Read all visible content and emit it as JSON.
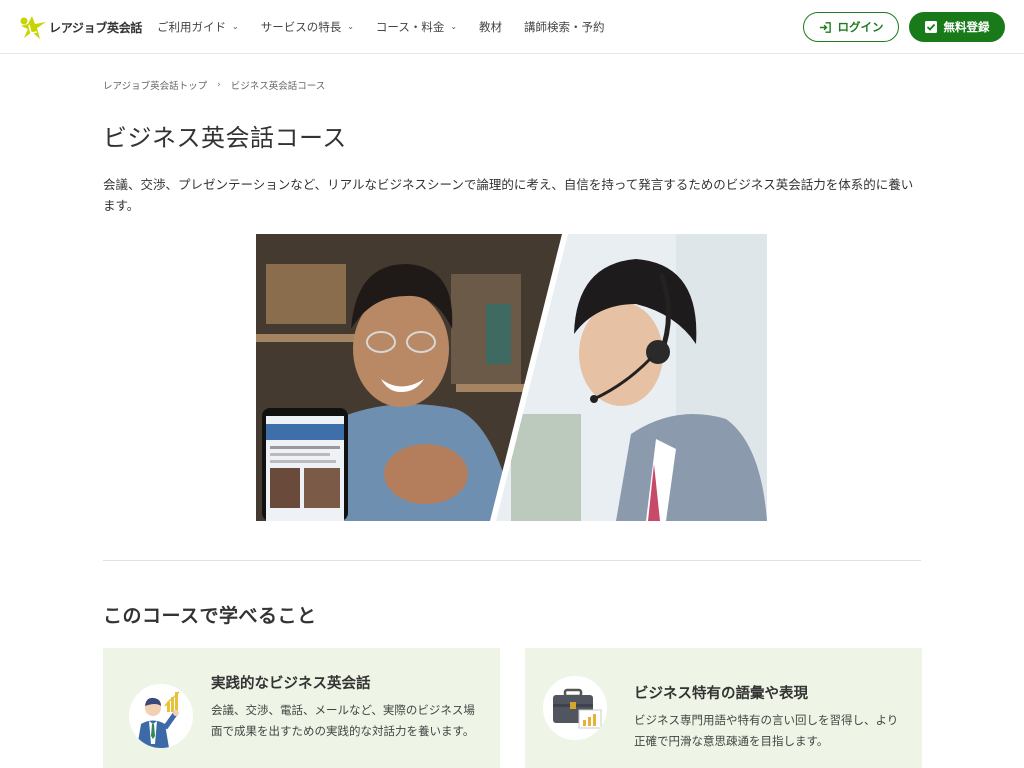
{
  "header": {
    "logo_text": "レアジョブ英会話",
    "nav": [
      {
        "label": "ご利用ガイド",
        "has_dropdown": true
      },
      {
        "label": "サービスの特長",
        "has_dropdown": true
      },
      {
        "label": "コース・料金",
        "has_dropdown": true
      },
      {
        "label": "教材",
        "has_dropdown": false
      },
      {
        "label": "講師検索・予約",
        "has_dropdown": false
      }
    ],
    "login_label": "ログイン",
    "register_label": "無料登録"
  },
  "breadcrumb": {
    "home": "レアジョブ英会話トップ",
    "current": "ビジネス英会話コース"
  },
  "page": {
    "title": "ビジネス英会話コース",
    "intro": "会議、交渉、プレゼンテーションなど、リアルなビジネスシーンで論理的に考え、自信を持って発言するためのビジネス英会話力を体系的に養います。"
  },
  "learn": {
    "title": "このコースで学べること",
    "cards": [
      {
        "title": "実践的なビジネス英会話",
        "desc": "会議、交渉、電話、メールなど、実際のビジネス場面で成果を出すための実践的な対話力を養います。",
        "icon": "businessman-chart-icon"
      },
      {
        "title": "ビジネス特有の語彙や表現",
        "desc": "ビジネス専門用語や特有の言い回しを習得し、より正確で円滑な意思疎通を目指します。",
        "icon": "briefcase-chart-icon"
      }
    ]
  },
  "colors": {
    "brand_green": "#187a18",
    "card_bg": "#eef5e6",
    "logo_yellow": "#c8d400"
  }
}
